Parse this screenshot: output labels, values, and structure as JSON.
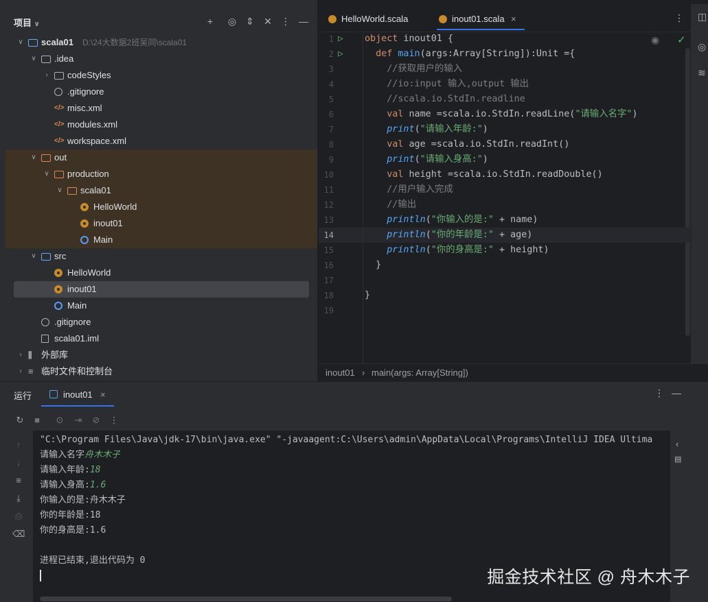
{
  "project_panel": {
    "title": "项目",
    "tree": [
      {
        "label": "scala01",
        "path": "D:\\24大数据2班吴同\\scala01",
        "depth": 0,
        "arrow": "v",
        "icon": "module-folder"
      },
      {
        "label": ".idea",
        "depth": 1,
        "arrow": "v",
        "icon": "folder"
      },
      {
        "label": "codeStyles",
        "depth": 2,
        "arrow": ">",
        "icon": "folder"
      },
      {
        "label": ".gitignore",
        "depth": 2,
        "icon": "ignore-file"
      },
      {
        "label": "misc.xml",
        "depth": 2,
        "icon": "xml-file"
      },
      {
        "label": "modules.xml",
        "depth": 2,
        "icon": "xml-file"
      },
      {
        "label": "workspace.xml",
        "depth": 2,
        "icon": "xml-file"
      },
      {
        "label": "out",
        "depth": 1,
        "arrow": "v",
        "icon": "folder-orange"
      },
      {
        "label": "production",
        "depth": 2,
        "arrow": "v",
        "icon": "folder-orange"
      },
      {
        "label": "scala01",
        "depth": 3,
        "arrow": "v",
        "icon": "folder-orange"
      },
      {
        "label": "HelloWorld",
        "depth": 4,
        "icon": "object"
      },
      {
        "label": "inout01",
        "depth": 4,
        "icon": "object"
      },
      {
        "label": "Main",
        "depth": 4,
        "icon": "class"
      },
      {
        "label": "src",
        "depth": 1,
        "arrow": "v",
        "icon": "folder-blue"
      },
      {
        "label": "HelloWorld",
        "depth": 2,
        "icon": "object"
      },
      {
        "label": "inout01",
        "depth": 2,
        "icon": "object",
        "selected": true
      },
      {
        "label": "Main",
        "depth": 2,
        "icon": "class"
      },
      {
        "label": ".gitignore",
        "depth": 1,
        "icon": "ignore-file"
      },
      {
        "label": "scala01.iml",
        "depth": 1,
        "icon": "iml-file"
      },
      {
        "label": "外部库",
        "depth": 0,
        "arrow": ">",
        "icon": "library"
      },
      {
        "label": "临时文件和控制台",
        "depth": 0,
        "arrow": ">",
        "icon": "scratch"
      }
    ]
  },
  "editor": {
    "tabs": [
      {
        "label": "HelloWorld.scala",
        "active": false
      },
      {
        "label": "inout01.scala",
        "active": true
      }
    ],
    "close_glyph": "×",
    "current_line": 14,
    "line_numbers": [
      "1",
      "2",
      "3",
      "4",
      "5",
      "6",
      "7",
      "8",
      "9",
      "10",
      "11",
      "12",
      "13",
      "14",
      "15",
      "16",
      "17",
      "18",
      "19"
    ],
    "code": [
      "object inout01 {",
      "  def main(args:Array[String]):Unit ={",
      "    //获取用户的输入",
      "    //io:input 输入,output 输出",
      "    //scala.io.StdIn.readline",
      "    val name =scala.io.StdIn.readLine(\"请输入名字\")",
      "    print(\"请输入年龄:\")",
      "    val age =scala.io.StdIn.readInt()",
      "    print(\"请输入身高:\")",
      "    val height =scala.io.StdIn.readDouble()",
      "    //用户输入完成",
      "    //输出",
      "    println(\"你输入的是:\" + name)",
      "    println(\"你的年龄是:\" + age)",
      "    println(\"你的身高是:\" + height)",
      "  }",
      "",
      "}",
      ""
    ],
    "breadcrumb": [
      "inout01",
      "main(args: Array[String])"
    ],
    "breadcrumb_sep": "›"
  },
  "run_panel": {
    "title": "运行",
    "tab_label": "inout01",
    "console": [
      {
        "prompt": "\"C:\\Program Files\\Java\\jdk-17\\bin\\java.exe\" \"-javaagent:C:\\Users\\admin\\AppData\\Local\\Programs\\IntelliJ IDEA Ultima",
        "input": ""
      },
      {
        "prompt": "请输入名字",
        "input": "舟木木子"
      },
      {
        "prompt": "请输入年龄:",
        "input": "18"
      },
      {
        "prompt": "请输入身高:",
        "input": "1.6"
      },
      {
        "prompt": "你输入的是:舟木木子",
        "input": ""
      },
      {
        "prompt": "你的年龄是:18",
        "input": ""
      },
      {
        "prompt": "你的身高是:1.6",
        "input": ""
      },
      {
        "prompt": "",
        "input": ""
      },
      {
        "prompt": "进程已结束,退出代码为 0",
        "input": ""
      }
    ]
  },
  "watermark": "掘金技术社区 @ 舟木木子",
  "colors": {
    "accent": "#3574f0",
    "keyword": "#cf8e6d",
    "function": "#56a8f5",
    "string": "#6aab73",
    "comment": "#7a7e85",
    "run_green": "#5fb865"
  }
}
